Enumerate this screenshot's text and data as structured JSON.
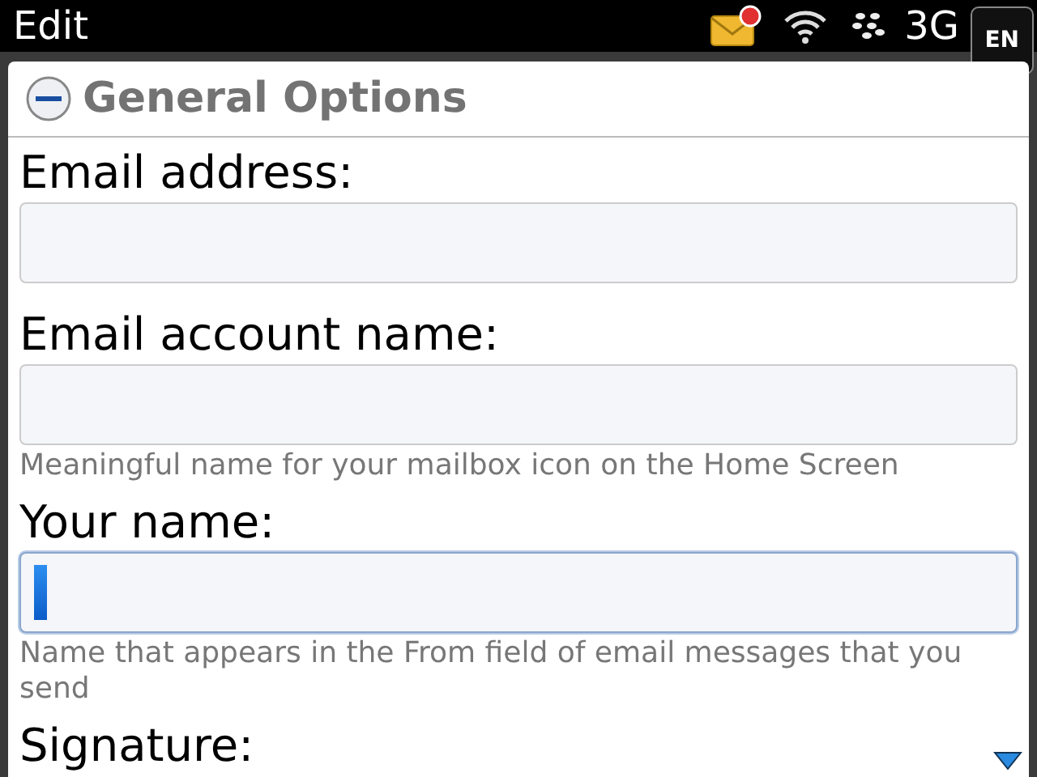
{
  "status_bar": {
    "title": "Edit",
    "network": "3G",
    "input_language": "EN",
    "new_mail": true
  },
  "section": {
    "title": "General Options",
    "expanded": true
  },
  "fields": [
    {
      "label": "Email address:",
      "focused": false
    },
    {
      "label": "Email account name:",
      "focused": false,
      "hint": "Meaningful name for your mailbox icon on the Home Screen"
    },
    {
      "label": "Your name:",
      "focused": true,
      "hint": "Name that appears in the From field of email messages that you send"
    },
    {
      "label": "Signature:"
    }
  ]
}
